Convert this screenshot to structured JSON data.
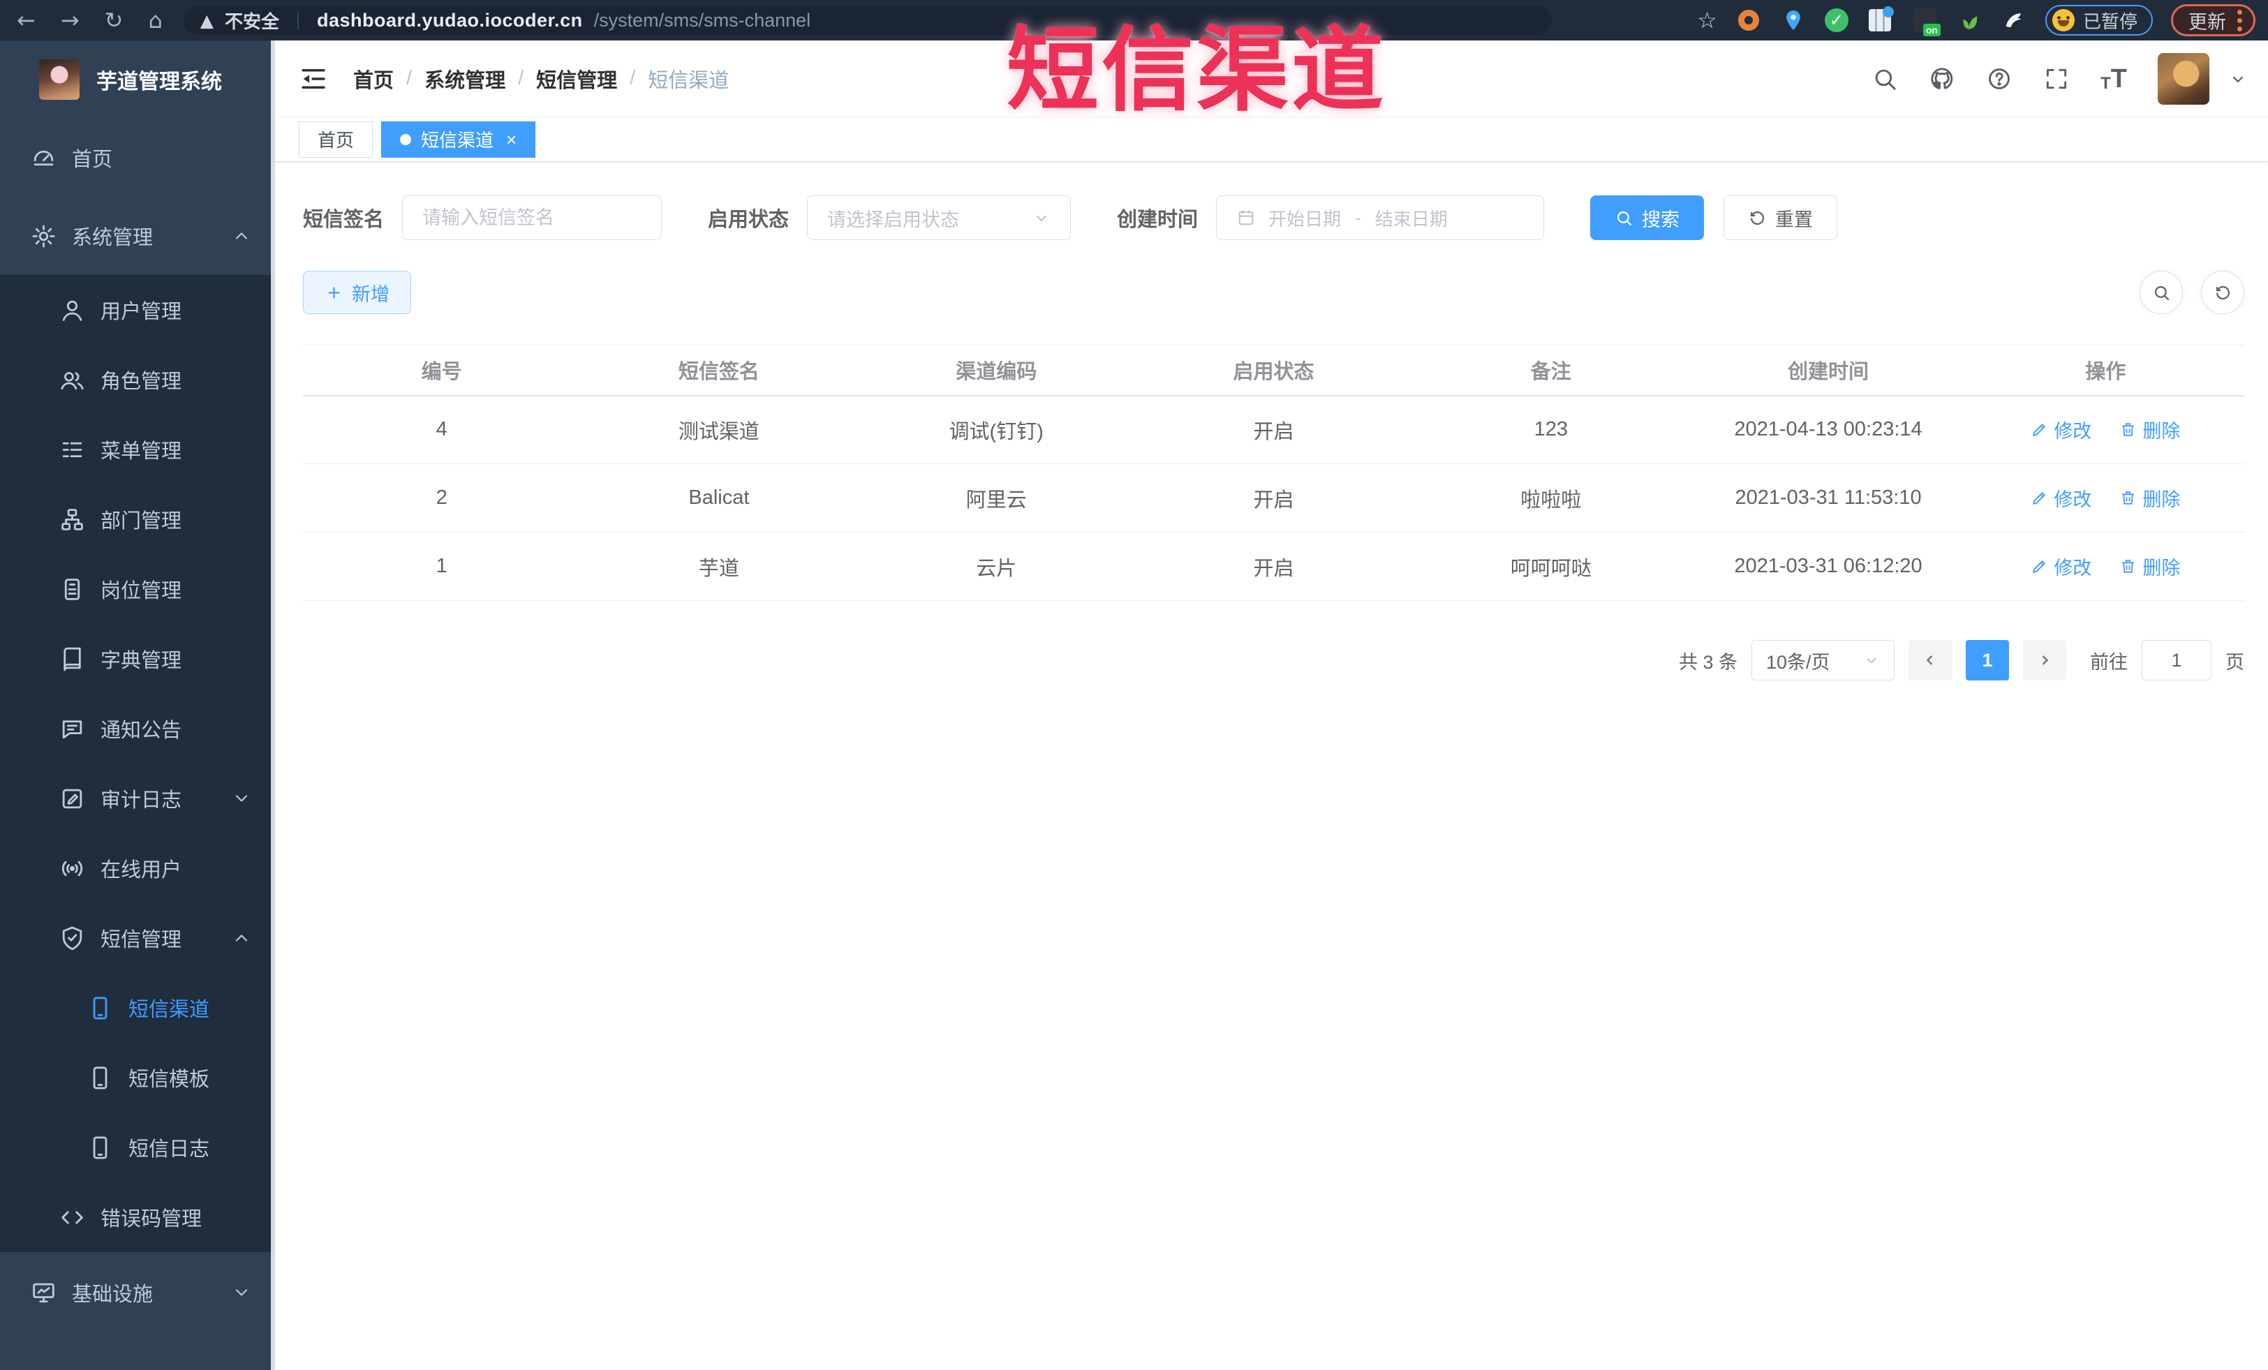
{
  "browser": {
    "security": "不安全",
    "url_domain": "dashboard.yudao.iocoder.cn",
    "url_path": "/system/sms/sms-channel",
    "paused": "已暂停",
    "update": "更新",
    "ext_on_badge": "on"
  },
  "watermark": "短信渠道",
  "colors": {
    "primary": "#409eff",
    "watermark_pink": "#ee3156",
    "sidebar_dark": "#1f2d3d",
    "sidebar_light": "#304156"
  },
  "sidebar": {
    "title": "芋道管理系统",
    "items": [
      {
        "label": "首页"
      },
      {
        "label": "系统管理"
      },
      {
        "label": "用户管理"
      },
      {
        "label": "角色管理"
      },
      {
        "label": "菜单管理"
      },
      {
        "label": "部门管理"
      },
      {
        "label": "岗位管理"
      },
      {
        "label": "字典管理"
      },
      {
        "label": "通知公告"
      },
      {
        "label": "审计日志"
      },
      {
        "label": "在线用户"
      },
      {
        "label": "短信管理"
      },
      {
        "label": "短信渠道"
      },
      {
        "label": "短信模板"
      },
      {
        "label": "短信日志"
      },
      {
        "label": "错误码管理"
      },
      {
        "label": "基础设施"
      }
    ]
  },
  "header": {
    "breadcrumb": [
      "首页",
      "系统管理",
      "短信管理",
      "短信渠道"
    ],
    "separator": "/"
  },
  "tabs": [
    {
      "label": "首页"
    },
    {
      "label": "短信渠道"
    }
  ],
  "filters": {
    "sign_label": "短信签名",
    "sign_placeholder": "请输入短信签名",
    "status_label": "启用状态",
    "status_placeholder": "请选择启用状态",
    "time_label": "创建时间",
    "start_placeholder": "开始日期",
    "range_separator": "-",
    "end_placeholder": "结束日期",
    "search": "搜索",
    "reset": "重置"
  },
  "toolbar": {
    "add": "新增"
  },
  "table": {
    "columns": [
      "编号",
      "短信签名",
      "渠道编码",
      "启用状态",
      "备注",
      "创建时间",
      "操作"
    ],
    "rows": [
      {
        "id": "4",
        "signature": "测试渠道",
        "code": "调试(钉钉)",
        "status": "开启",
        "remark": "123",
        "created": "2021-04-13 00:23:14"
      },
      {
        "id": "2",
        "signature": "Balicat",
        "code": "阿里云",
        "status": "开启",
        "remark": "啦啦啦",
        "created": "2021-03-31 11:53:10"
      },
      {
        "id": "1",
        "signature": "芋道",
        "code": "云片",
        "status": "开启",
        "remark": "呵呵呵哒",
        "created": "2021-03-31 06:12:20"
      }
    ],
    "actions": {
      "edit": "修改",
      "delete": "删除"
    }
  },
  "pagination": {
    "total": "共 3 条",
    "page_size": "10条/页",
    "page": "1",
    "jump_prefix": "前往",
    "jump_value": "1",
    "jump_suffix": "页"
  }
}
